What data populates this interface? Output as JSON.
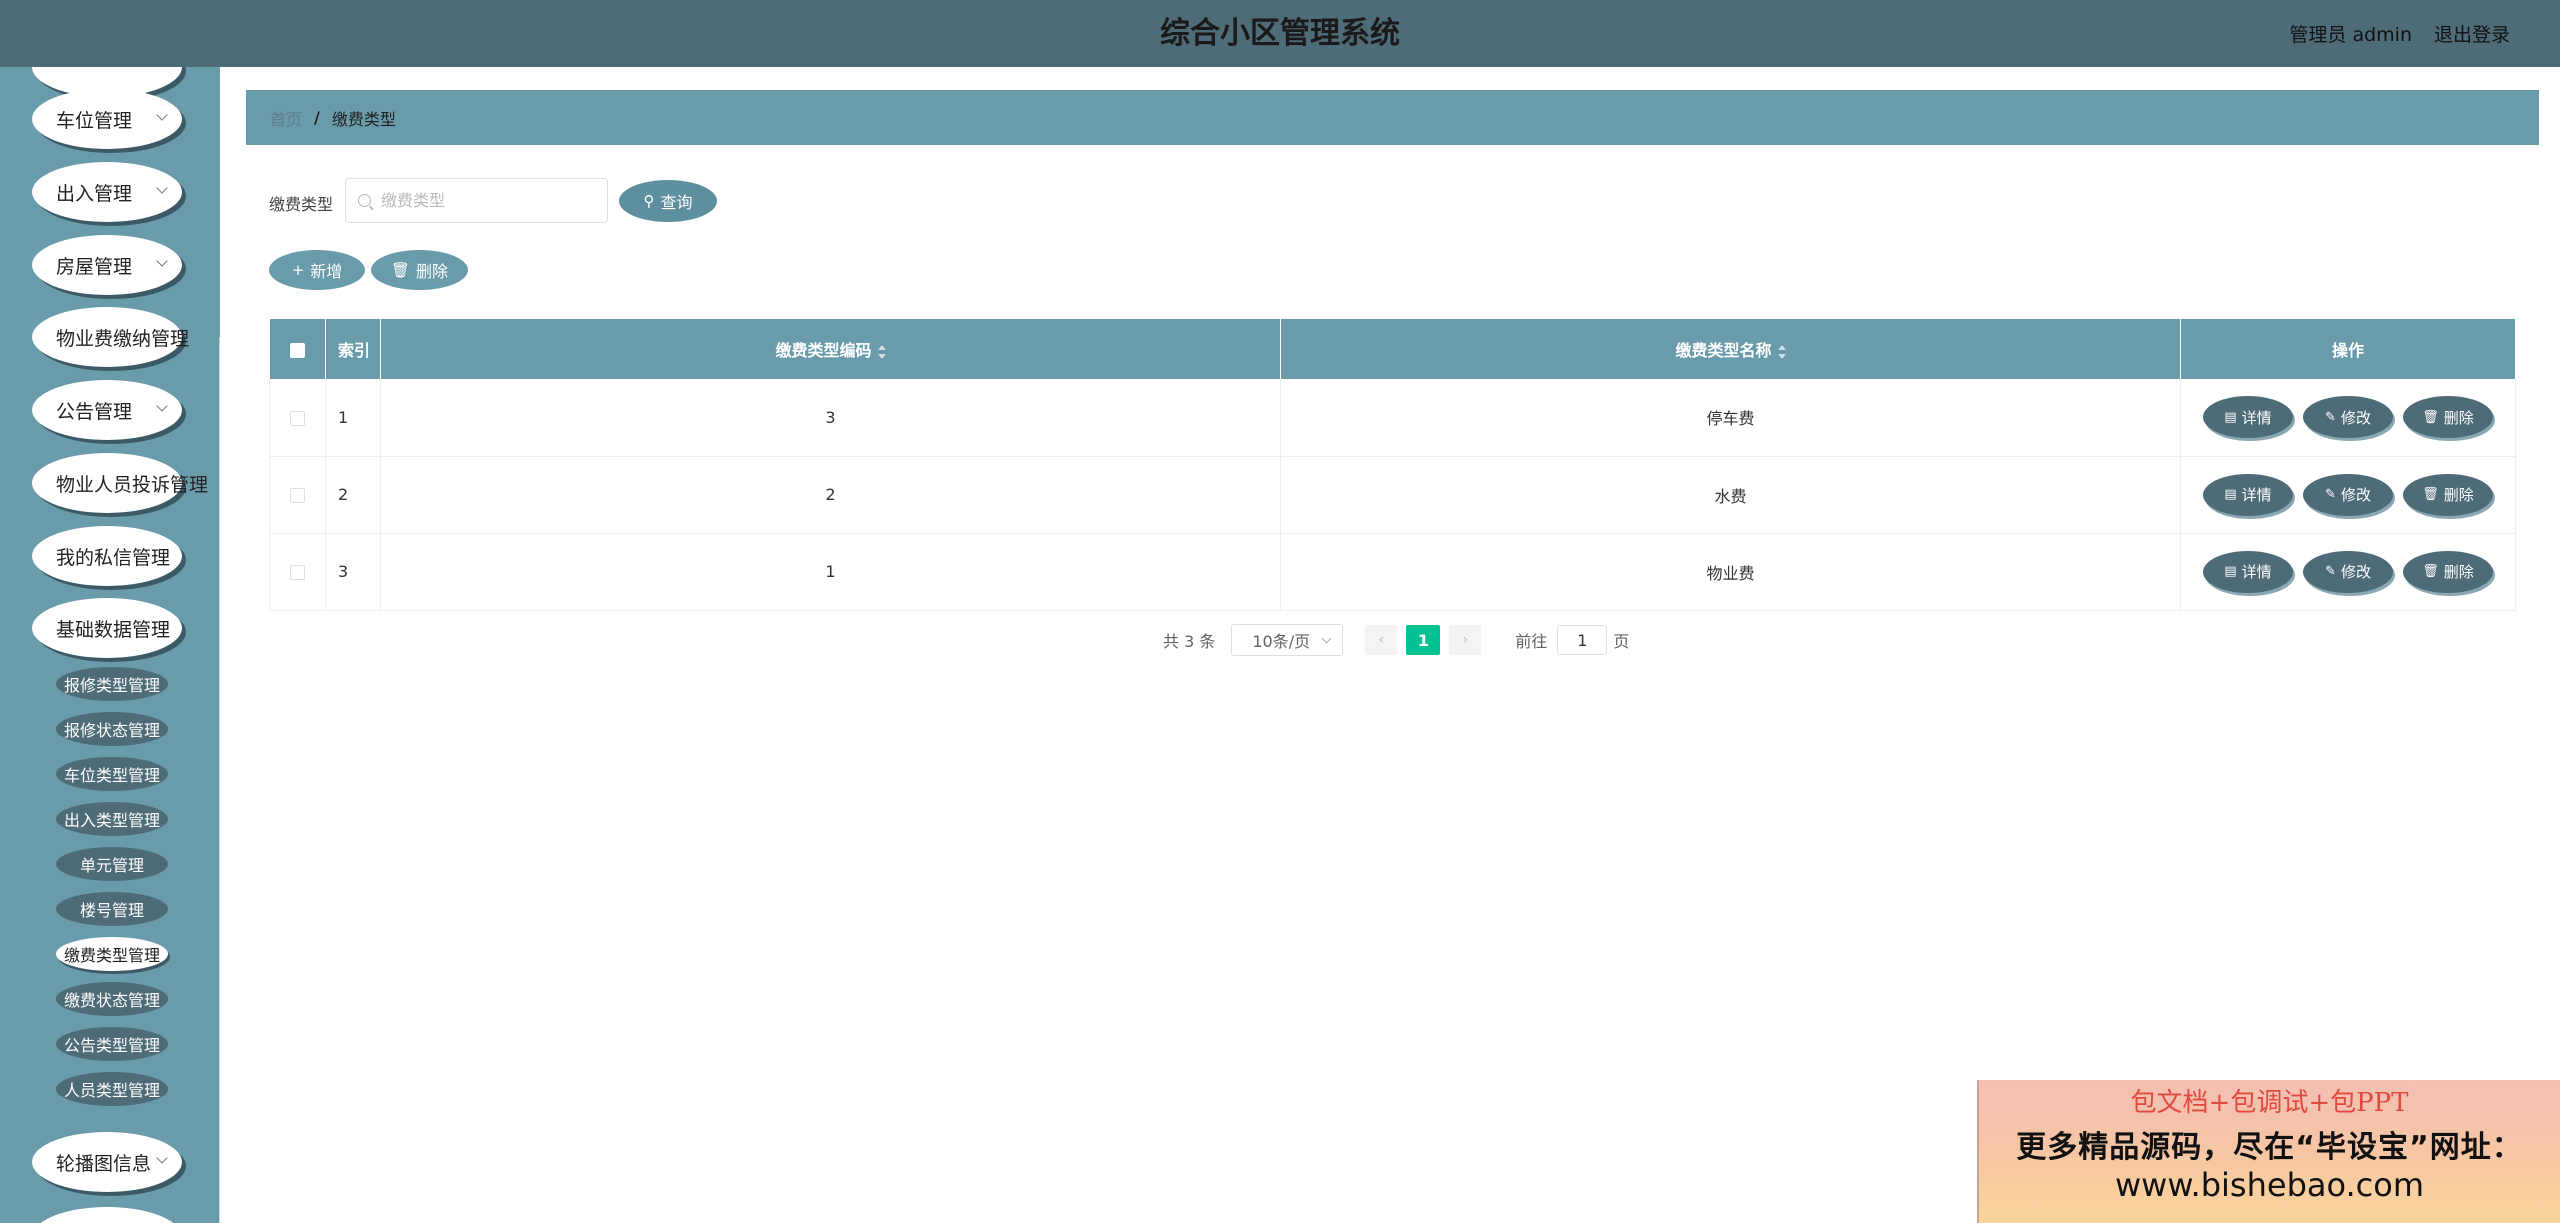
{
  "header": {
    "title": "综合小区管理系统",
    "user": "管理员 admin",
    "logout": "退出登录"
  },
  "sidebar": {
    "items": [
      {
        "label": "车位管理"
      },
      {
        "label": "出入管理"
      },
      {
        "label": "房屋管理"
      },
      {
        "label": "物业费缴纳管理"
      },
      {
        "label": "公告管理"
      },
      {
        "label": "物业人员投诉管理"
      },
      {
        "label": "我的私信管理"
      },
      {
        "label": "基础数据管理"
      }
    ],
    "sub_items": [
      {
        "label": "报修类型管理"
      },
      {
        "label": "报修状态管理"
      },
      {
        "label": "车位类型管理"
      },
      {
        "label": "出入类型管理"
      },
      {
        "label": "单元管理"
      },
      {
        "label": "楼号管理"
      },
      {
        "label": "缴费类型管理",
        "active": true
      },
      {
        "label": "缴费状态管理"
      },
      {
        "label": "公告类型管理"
      },
      {
        "label": "人员类型管理"
      }
    ],
    "last_item": {
      "label": "轮播图信息"
    }
  },
  "breadcrumb": {
    "home": "首页",
    "separator": "/",
    "current": "缴费类型"
  },
  "search": {
    "label": "缴费类型",
    "placeholder": "缴费类型",
    "value": "",
    "query_button": "查询"
  },
  "toolbar": {
    "add_label": "新增",
    "delete_label": "删除"
  },
  "table": {
    "headers": {
      "index": "索引",
      "code": "缴费类型编码",
      "name": "缴费类型名称",
      "actions": "操作"
    },
    "rows": [
      {
        "index": "1",
        "code": "3",
        "name": "停车费"
      },
      {
        "index": "2",
        "code": "2",
        "name": "水费"
      },
      {
        "index": "3",
        "code": "1",
        "name": "物业费"
      }
    ],
    "row_actions": {
      "detail": "详情",
      "edit": "修改",
      "delete": "删除"
    }
  },
  "pagination": {
    "total": "共 3 条",
    "page_size": "10条/页",
    "current_page": "1",
    "goto_prefix": "前往",
    "goto_value": "1",
    "goto_suffix": "页"
  },
  "watermark": {
    "line1": "包文档+包调试+包PPT",
    "line2": "更多精品源码，尽在“毕设宝”网址：",
    "line3": "www.bishebao.com"
  },
  "colors": {
    "header_bg": "#4e6b78",
    "sidebar_bg": "#6a9bab",
    "accent_dark": "#4e6b78",
    "active_page": "#00c292"
  }
}
